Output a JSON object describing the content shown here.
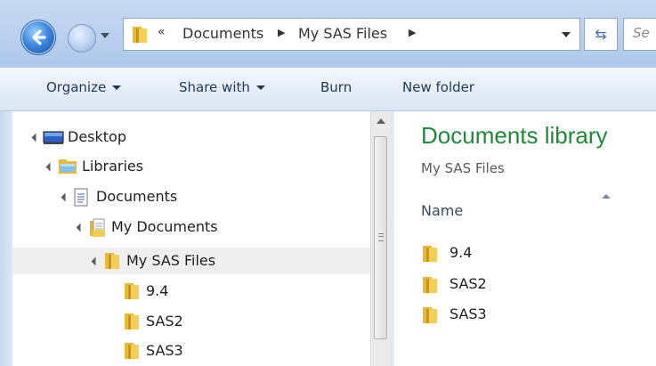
{
  "address_bar": {
    "chevrons": "«",
    "breadcrumbs": [
      "Documents",
      "My SAS Files"
    ],
    "search_placeholder": "Se"
  },
  "toolbar": {
    "organize": "Organize",
    "share_with": "Share with",
    "burn": "Burn",
    "new_folder": "New folder"
  },
  "nav_tree": {
    "desktop": "Desktop",
    "libraries": "Libraries",
    "documents": "Documents",
    "my_documents": "My Documents",
    "my_sas_files": "My SAS Files",
    "children": [
      "9.4",
      "SAS2",
      "SAS3"
    ]
  },
  "content": {
    "title": "Documents library",
    "subtitle": "My SAS Files",
    "column_name": "Name",
    "files": [
      "9.4",
      "SAS2",
      "SAS3"
    ]
  },
  "colors": {
    "library_title": "#1e8a3c",
    "selected_row": "#efefef",
    "toolbar_text": "#1e395b"
  }
}
